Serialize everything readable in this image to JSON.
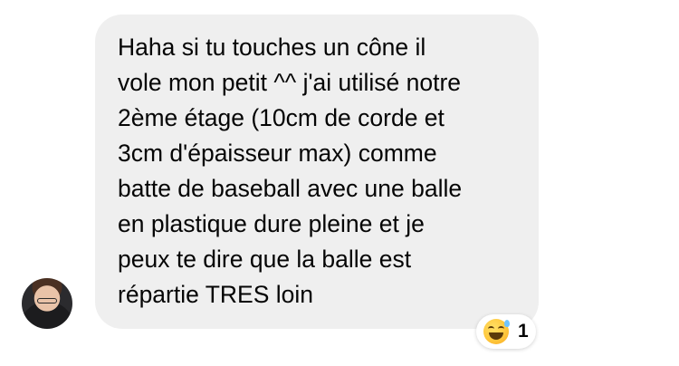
{
  "message": {
    "text": "Haha si tu touches un cône il\nvole mon petit ^^ j'ai utilisé notre\n2ème étage (10cm de corde et\n3cm d'épaisseur max) comme\nbatte de baseball avec une balle\nen plastique dure pleine et je\npeux te dire que la balle est\nrépartie TRES loin",
    "bubble_color": "#efefef"
  },
  "reaction": {
    "emoji": "grinning-squinting-face-with-sweat",
    "count": "1"
  },
  "sender": {
    "avatar": "profile-photo"
  }
}
